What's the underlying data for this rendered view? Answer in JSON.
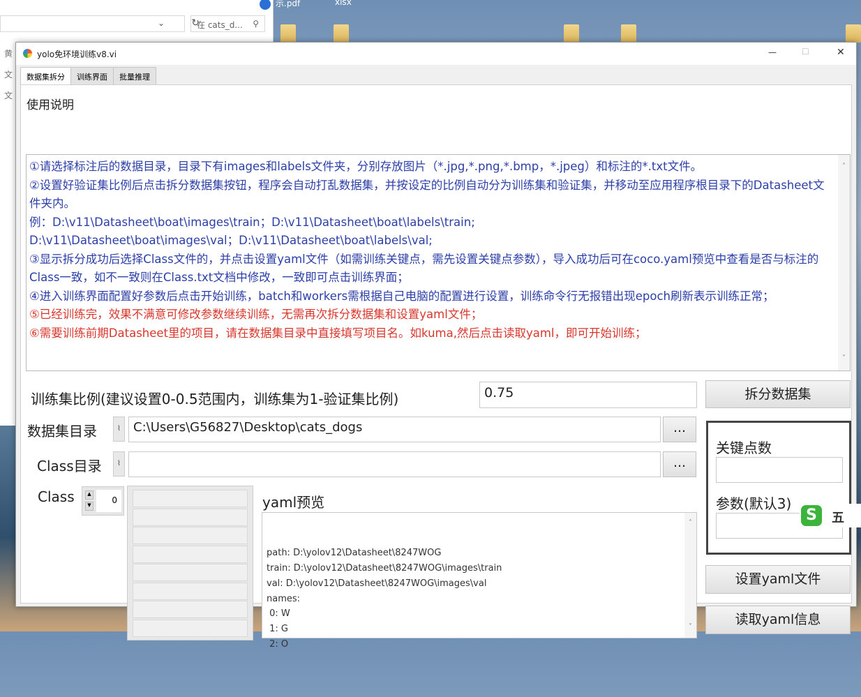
{
  "explorer": {
    "search_placeholder": "在 cats_d...",
    "desktop_labels": [
      "示.pdf",
      "xlsx"
    ],
    "side_chars": [
      "黄",
      "文",
      "文"
    ]
  },
  "window": {
    "title": "yolo免环境训练v8.vi",
    "minimize": "—",
    "maximize": "☐",
    "close": "✕"
  },
  "tabs": [
    {
      "label": "数据集拆分"
    },
    {
      "label": "训练界面"
    },
    {
      "label": "批量推理"
    }
  ],
  "instructions": {
    "heading": "使用说明",
    "lines": [
      "①请选择标注后的数据目录，目录下有images和labels文件夹，分别存放图片（*.jpg,*.png,*.bmp，*.jpeg）和标注的*.txt文件。",
      "②设置好验证集比例后点击拆分数据集按钮，程序会自动打乱数据集，并按设定的比例自动分为训练集和验证集，并移动至应用程序根目录下的Datasheet文件夹内。",
      "例：D:\\v11\\Datasheet\\boat\\images\\train；D:\\v11\\Datasheet\\boat\\labels\\train;",
      "D:\\v11\\Datasheet\\boat\\images\\val；D:\\v11\\Datasheet\\boat\\labels\\val;",
      "③显示拆分成功后选择Class文件的，并点击设置yaml文件（如需训练关键点，需先设置关键点参数），导入成功后可在coco.yaml预览中查看是否与标注的Class一致，如不一致则在Class.txt文档中修改，一致即可点击训练界面；",
      "④进入训练界面配置好参数后点击开始训练，batch和workers需根据自己电脑的配置进行设置，训练命令行无报错出现epoch刷新表示训练正常；",
      "⑤已经训练完，效果不满意可修改参数继续训练，无需再次拆分数据集和设置yaml文件；",
      "⑥需要训练前期Datasheet里的项目，请在数据集目录中直接填写项目名。如kuma,然后点击读取yaml，即可开始训练；"
    ]
  },
  "ratio": {
    "label": "训练集比例(建议设置0-0.5范围内，训练集为1-验证集比例)",
    "value": "0.75",
    "split_button": "拆分数据集"
  },
  "dataset_dir": {
    "label": "数据集目录",
    "value": "C:\\Users\\G56827\\Desktop\\cats_dogs",
    "browse": "..."
  },
  "class_dir": {
    "label": "Class目录",
    "value": "",
    "browse": "..."
  },
  "class": {
    "label": "Class",
    "index": "0"
  },
  "yaml": {
    "label": "yaml预览",
    "lines": [
      "path: D:\\yolov12\\Datasheet\\8247WOG",
      "train: D:\\yolov12\\Datasheet\\8247WOG\\images\\train",
      "val: D:\\yolov12\\Datasheet\\8247WOG\\images\\val",
      "names:",
      " 0: W",
      " 1: G",
      " 2: O"
    ]
  },
  "keypoints": {
    "count_label": "关键点数",
    "count_value": "",
    "param_label": "参数(默认3)",
    "param_value": ""
  },
  "buttons": {
    "set_yaml": "设置yaml文件",
    "read_yaml": "读取yaml信息"
  },
  "ime": {
    "label": "五"
  },
  "colors": {
    "instruction_blue": "#2c3fa8",
    "instruction_red": "#d9372c"
  }
}
